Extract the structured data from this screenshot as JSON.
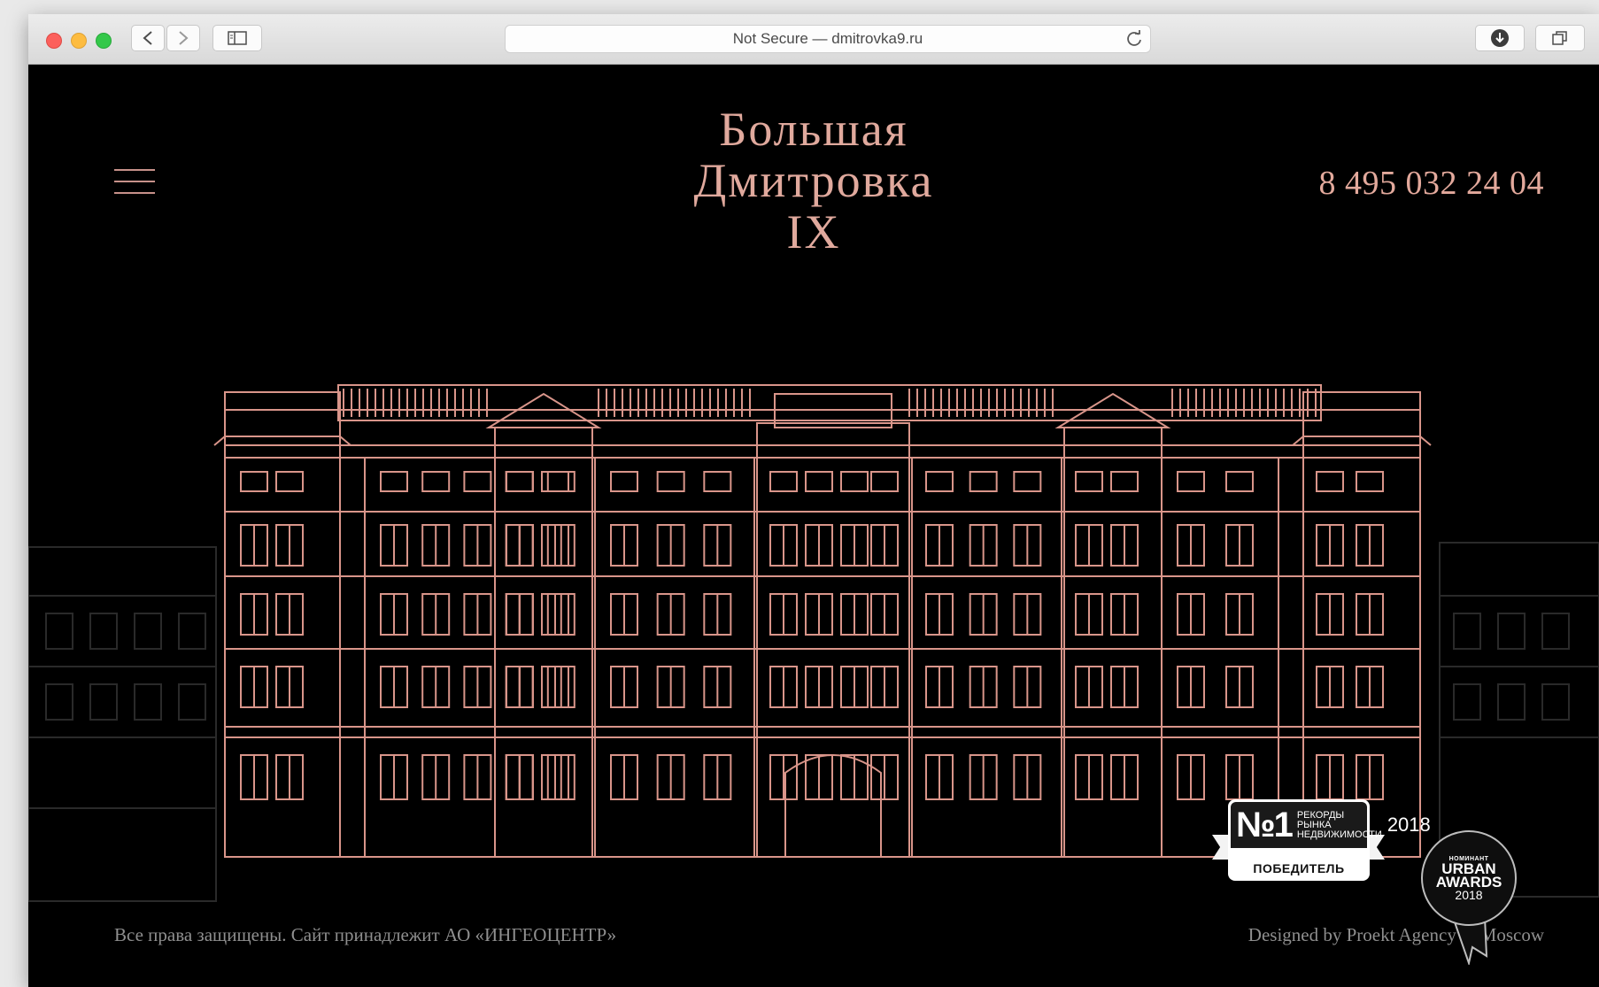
{
  "browser": {
    "address": "Not Secure — dmitrovka9.ru",
    "traffic_lights": [
      "close",
      "minimize",
      "zoom"
    ],
    "icons": [
      "back-icon",
      "forward-icon",
      "sidebar-icon",
      "reload-icon",
      "download-icon",
      "tabs-icon"
    ]
  },
  "site": {
    "title_lines": [
      "Большая",
      "Дмитровка",
      "IX"
    ],
    "phone": "8 495 032 24 04",
    "footer_left": "Все права защищены. Сайт принадлежит АО «ИНГЕОЦЕНТР»",
    "footer_right": "Designed by Proekt Agency in Moscow"
  },
  "badges": {
    "records": {
      "number": "№1",
      "label_lines": [
        "РЕКОРДЫ",
        "РЫНКА",
        "НЕДВИЖИМОСТИ"
      ],
      "year": "2018",
      "status": "ПОБЕДИТЕЛЬ"
    },
    "urban": {
      "nominee": "НОМИНАНТ",
      "line1": "URBAN",
      "line2": "AWARDS",
      "year": "2018"
    }
  },
  "colors": {
    "accent": "#e0a99d",
    "background": "#000000",
    "footer_text": "#8f8f8f"
  }
}
